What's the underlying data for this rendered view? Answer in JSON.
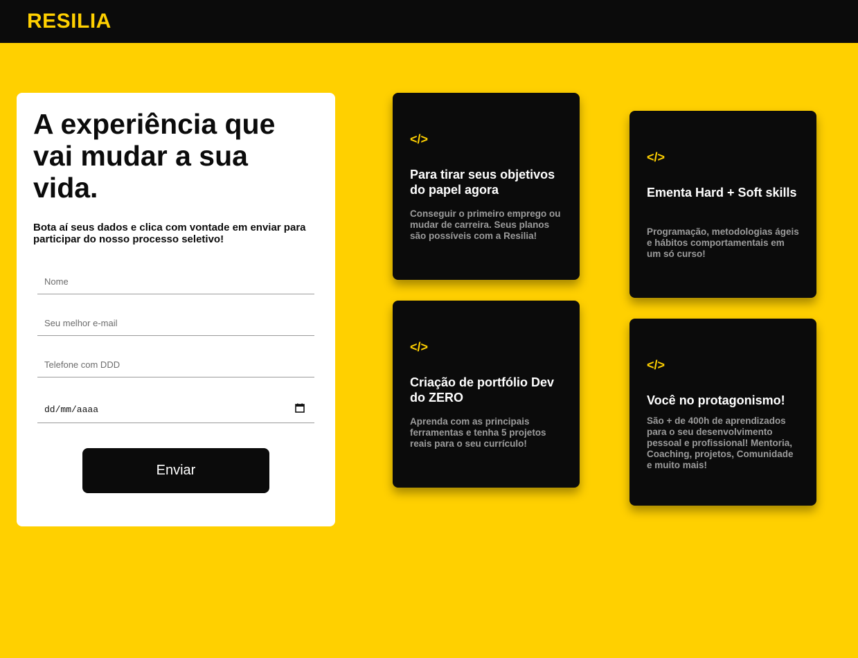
{
  "header": {
    "logo": "RESILIA"
  },
  "form": {
    "headline": "A experiência que vai mudar a sua vida.",
    "lead": "Bota aí seus dados e clica com vontade em enviar para participar do nosso processo seletivo!",
    "name_placeholder": "Nome",
    "email_placeholder": "Seu melhor e-mail",
    "phone_placeholder": "Telefone com DDD",
    "date_placeholder": "dd/mm/aaaa",
    "submit_label": "Enviar"
  },
  "features": [
    {
      "icon": "</>",
      "title": "Para tirar seus objetivos do papel agora",
      "text": "Conseguir o primeiro emprego ou mudar de carreira. Seus planos são possíveis com a Resilia!"
    },
    {
      "icon": "</>",
      "title": "Ementa Hard + Soft skills",
      "text": "Programação, metodologias ágeis e hábitos comportamentais em um só curso!"
    },
    {
      "icon": "</>",
      "title": "Criação de portfólio Dev do ZERO",
      "text": "Aprenda com as principais ferramentas e tenha 5 projetos reais para o seu currículo!"
    },
    {
      "icon": "</>",
      "title": "Você no protagonismo!",
      "text": "São + de 400h de aprendizados para o seu desenvolvimento pessoal e profissional! Mentoria, Coaching, projetos, Comunidade e muito mais!"
    }
  ],
  "colors": {
    "accent": "#ffd000",
    "dark": "#0b0b0b",
    "card": "#ffffff",
    "muted_text": "#9c9c9c"
  },
  "icons": {
    "code": "code-icon",
    "calendar": "calendar-icon"
  }
}
